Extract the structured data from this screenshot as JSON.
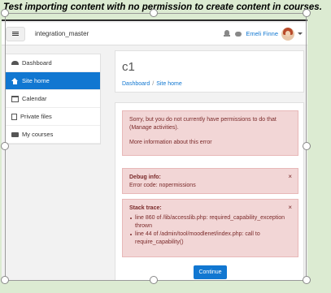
{
  "caption": "Test importing content with no permission to create content in courses.",
  "navbar": {
    "site_name": "integration_master",
    "user_name": "Emeli Finne"
  },
  "sidebar": {
    "items": [
      {
        "label": "Dashboard",
        "icon": "dashboard-icon"
      },
      {
        "label": "Site home",
        "icon": "home-icon",
        "active": true
      },
      {
        "label": "Calendar",
        "icon": "calendar-icon"
      },
      {
        "label": "Private files",
        "icon": "file-icon"
      },
      {
        "label": "My courses",
        "icon": "folder-icon"
      }
    ]
  },
  "header": {
    "course_title": "c1",
    "breadcrumb": [
      "Dashboard",
      "Site home"
    ]
  },
  "error": {
    "message_line1": "Sorry, but you do not currently have permissions to do that",
    "message_line2": "(Manage activities).",
    "more_info": "More information about this error"
  },
  "debug": {
    "title": "Debug info:",
    "code": "Error code: nopermissions",
    "close": "×"
  },
  "trace": {
    "title": "Stack trace:",
    "close": "×",
    "items": [
      "line 860 of /lib/accesslib.php: required_capability_exception thrown",
      "line 44 of /admin/tool/moodlenet/index.php: call to require_capability()"
    ]
  },
  "continue_label": "Continue",
  "colors": {
    "accent": "#1177d1",
    "alert_bg": "#f2d6d6",
    "alert_text": "#7a2a2a",
    "page_bg": "#dcebd2"
  }
}
